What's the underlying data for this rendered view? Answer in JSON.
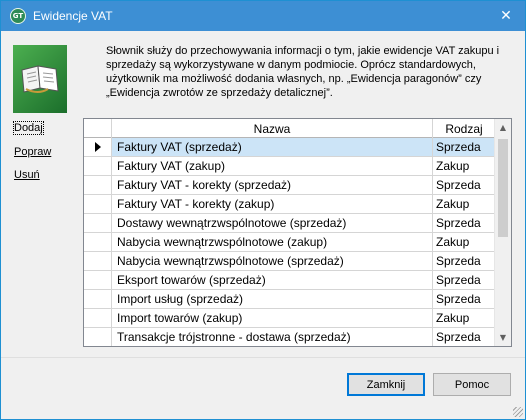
{
  "window": {
    "title": "Ewidencje VAT",
    "app_icon_text": "GT",
    "close_symbol": "✕"
  },
  "description": "Słownik służy do przechowywania informacji o tym, jakie ewidencje VAT zakupu i sprzedaży są wykorzystywane w danym podmiocie. Oprócz standardowych, użytkownik ma możliwość dodania własnych, np. „Ewidencja paragonów” czy „Ewidencja zwrotów ze sprzedaży detalicznej”.",
  "sidebar": {
    "add": "Dodaj",
    "edit": "Popraw",
    "delete": "Usuń"
  },
  "grid": {
    "columns": [
      "Nazwa",
      "Rodzaj"
    ],
    "selected_index": 0,
    "rows": [
      {
        "name": "Faktury VAT (sprzedaż)",
        "type": "Sprzeda"
      },
      {
        "name": "Faktury VAT (zakup)",
        "type": "Zakup"
      },
      {
        "name": "Faktury VAT - korekty (sprzedaż)",
        "type": "Sprzeda"
      },
      {
        "name": "Faktury VAT - korekty (zakup)",
        "type": "Zakup"
      },
      {
        "name": "Dostawy wewnątrzwspólnotowe (sprzedaż)",
        "type": "Sprzeda"
      },
      {
        "name": "Nabycia wewnątrzwspólnotowe (zakup)",
        "type": "Zakup"
      },
      {
        "name": "Nabycia wewnątrzwspólnotowe (sprzedaż)",
        "type": "Sprzeda"
      },
      {
        "name": "Eksport towarów (sprzedaż)",
        "type": "Sprzeda"
      },
      {
        "name": "Import usług (sprzedaż)",
        "type": "Sprzeda"
      },
      {
        "name": "Import towarów (zakup)",
        "type": "Zakup"
      },
      {
        "name": "Transakcje trójstronne - dostawa (sprzedaż)",
        "type": "Sprzeda"
      }
    ]
  },
  "buttons": {
    "close": "Zamknij",
    "help": "Pomoc"
  },
  "colors": {
    "titlebar": "#3d8fd4",
    "selection": "#cce4f7"
  }
}
